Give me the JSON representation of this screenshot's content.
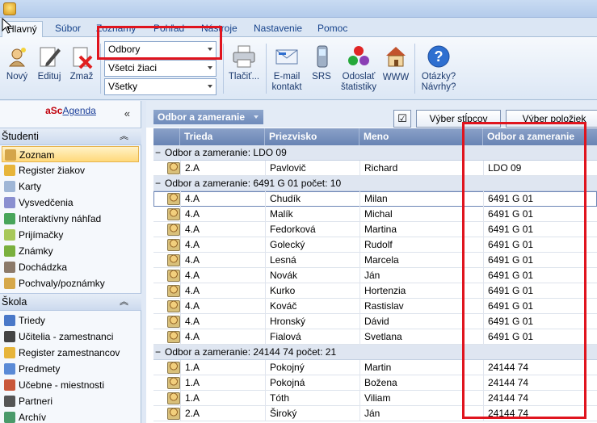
{
  "menu": {
    "tabs": [
      "Hlavný",
      "Súbor",
      "Zoznamy",
      "Pohľad",
      "Nástroje",
      "Nastavenie",
      "Pomoc"
    ]
  },
  "ribbon": {
    "new_label": "Nový",
    "edit_label": "Edituj",
    "delete_label": "Zmaž",
    "combo_grouping": "Odbory",
    "combo_students": "Všetci žiaci",
    "combo_all": "Všetky",
    "print_label": "Tlačiť...",
    "email_line1": "E-mail",
    "email_line2": "kontakt",
    "srs_label": "SRS",
    "stats_line1": "Odoslať",
    "stats_line2": "štatistiky",
    "www_label": "WWW",
    "questions_line1": "Otázky?",
    "questions_line2": "Návrhy?"
  },
  "sidebar": {
    "brand_a": "aSc",
    "brand_rest": "Agenda",
    "collapse": "«",
    "group1": "Študenti",
    "group2": "Škola",
    "students_items": [
      "Zoznam",
      "Register žiakov",
      "Karty",
      "Vysvedčenia",
      "Interaktívny náhľad",
      "Prijímačky",
      "Známky",
      "Dochádzka",
      "Pochvaly/poznámky"
    ],
    "school_items": [
      "Triedy",
      "Učitelia - zamestnanci",
      "Register zamestnancov",
      "Predmety",
      "Učebne - miestnosti",
      "Partneri",
      "Archív"
    ]
  },
  "grid": {
    "group_chip": "Odbor a zameranie",
    "check_glyph": "☑",
    "select_columns": "Výber stĺpcov",
    "select_items": "Výber položiek",
    "columns": [
      "Trieda",
      "Priezvisko",
      "Meno",
      "Odbor a zameranie"
    ],
    "groups": [
      {
        "label": "Odbor a zameranie:  LDO 09",
        "rows": [
          [
            "2.A",
            "Pavlovič",
            "Richard",
            "LDO 09"
          ]
        ]
      },
      {
        "label": "Odbor a zameranie:  6491 G 01 počet: 10",
        "rows": [
          [
            "4.A",
            "Chudík",
            "Milan",
            "6491 G 01"
          ],
          [
            "4.A",
            "Malík",
            "Michal",
            "6491 G 01"
          ],
          [
            "4.A",
            "Fedorková",
            "Martina",
            "6491 G 01"
          ],
          [
            "4.A",
            "Golecký",
            "Rudolf",
            "6491 G 01"
          ],
          [
            "4.A",
            "Lesná",
            "Marcela",
            "6491 G 01"
          ],
          [
            "4.A",
            "Novák",
            "Ján",
            "6491 G 01"
          ],
          [
            "4.A",
            "Kurko",
            "Hortenzia",
            "6491 G 01"
          ],
          [
            "4.A",
            "Kováč",
            "Rastislav",
            "6491 G 01"
          ],
          [
            "4.A",
            "Hronský",
            "Dávid",
            "6491 G 01"
          ],
          [
            "4.A",
            "Fialová",
            "Svetlana",
            "6491 G 01"
          ]
        ]
      },
      {
        "label": "Odbor a zameranie:  24144 74 počet: 21",
        "rows": [
          [
            "1.A",
            "Pokojný",
            "Martin",
            "24144 74"
          ],
          [
            "1.A",
            "Pokojná",
            "Božena",
            "24144 74"
          ],
          [
            "1.A",
            "Tóth",
            "Viliam",
            "24144 74"
          ],
          [
            "2.A",
            "Široký",
            "Ján",
            "24144 74"
          ]
        ]
      }
    ]
  }
}
